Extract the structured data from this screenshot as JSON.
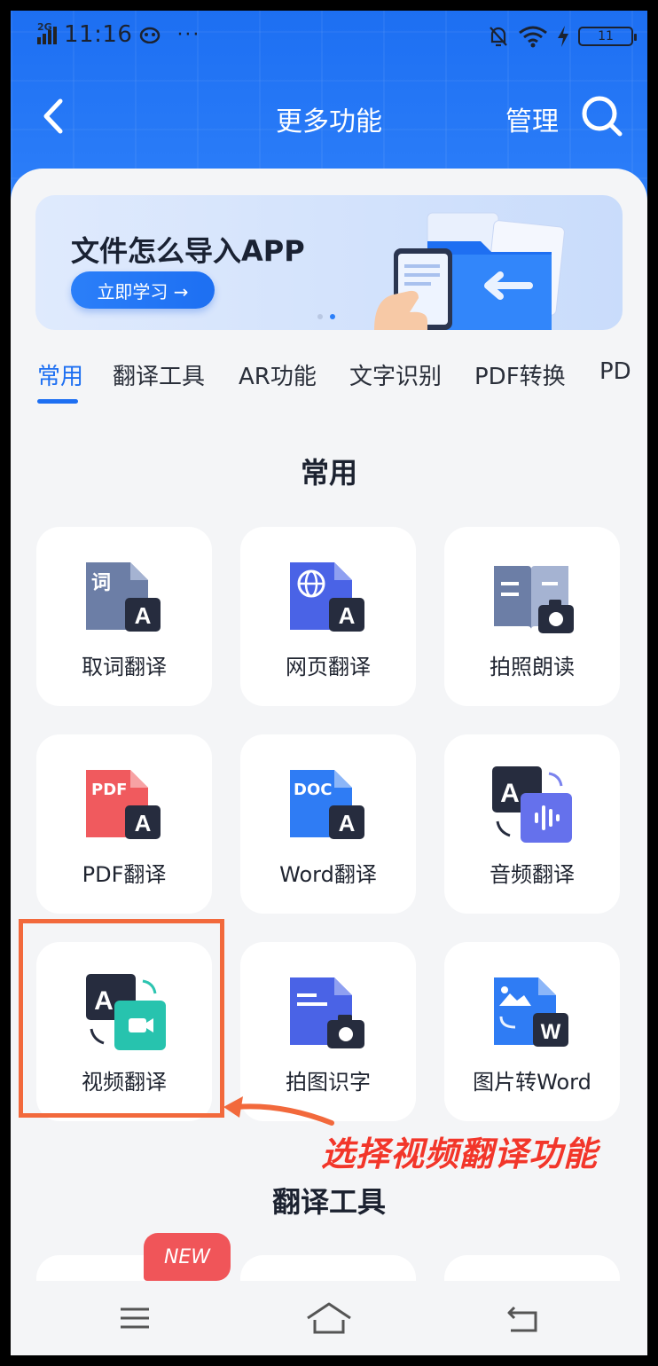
{
  "status_bar": {
    "network": "2G",
    "time": "11:16",
    "more": "···",
    "battery": "11"
  },
  "nav": {
    "title": "更多功能",
    "manage": "管理"
  },
  "banner": {
    "title": "文件怎么导入APP",
    "button": "立即学习 →"
  },
  "tabs": [
    "常用",
    "翻译工具",
    "AR功能",
    "文字识别",
    "PDF转换",
    "PD"
  ],
  "sections": {
    "common": {
      "title": "常用",
      "items": [
        {
          "label": "取词翻译",
          "icon": "word-pick-translate-icon",
          "glyph": "词"
        },
        {
          "label": "网页翻译",
          "icon": "web-translate-icon"
        },
        {
          "label": "拍照朗读",
          "icon": "photo-read-aloud-icon"
        },
        {
          "label": "PDF翻译",
          "icon": "pdf-translate-icon",
          "glyph": "PDF"
        },
        {
          "label": "Word翻译",
          "icon": "word-translate-icon",
          "glyph": "DOC"
        },
        {
          "label": "音频翻译",
          "icon": "audio-translate-icon"
        },
        {
          "label": "视频翻译",
          "icon": "video-translate-icon"
        },
        {
          "label": "拍图识字",
          "icon": "photo-ocr-icon"
        },
        {
          "label": "图片转Word",
          "icon": "image-to-word-icon"
        }
      ]
    },
    "translate_tools": {
      "title": "翻译工具",
      "badge": "NEW"
    }
  },
  "annotation": {
    "text": "选择视频翻译功能"
  },
  "glyphs": {
    "letter_a": "A",
    "letter_w": "W"
  },
  "colors": {
    "brand_blue": "#1d6ff2",
    "annotation_orange": "#f2693c",
    "annotation_red": "#f2362a",
    "badge_red": "#f05559"
  }
}
